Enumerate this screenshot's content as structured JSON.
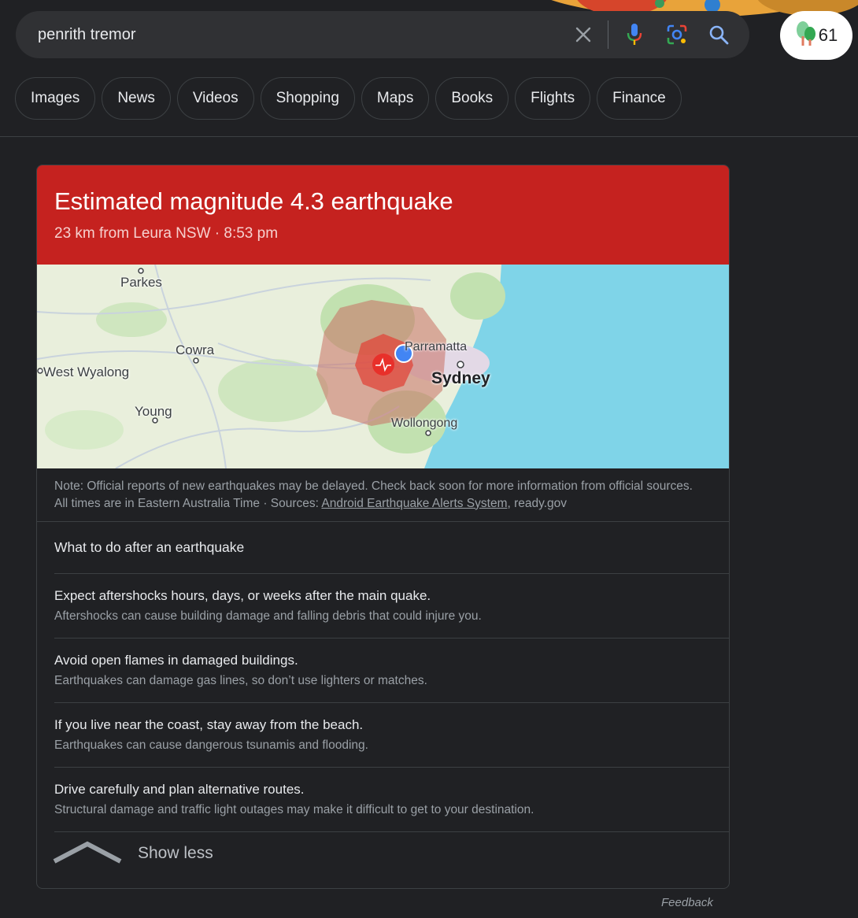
{
  "search": {
    "query": "penrith tremor",
    "clear_icon": "close-icon",
    "voice_icon": "microphone-icon",
    "lens_icon": "camera-lens-icon",
    "search_icon": "search-icon"
  },
  "badge": {
    "icon": "tree-icon",
    "count": "61"
  },
  "chips": [
    "Images",
    "News",
    "Videos",
    "Shopping",
    "Maps",
    "Books",
    "Flights",
    "Finance"
  ],
  "alert": {
    "title": "Estimated magnitude 4.3 earthquake",
    "subtitle": "23 km from Leura NSW · 8:53 pm",
    "color": "#c5221f"
  },
  "map": {
    "labels": [
      "Parkes",
      "Cowra",
      "West Wyalong",
      "Young",
      "Parramatta",
      "Sydney",
      "Wollongong"
    ]
  },
  "note": {
    "line1": "Note: Official reports of new earthquakes may be delayed. Check back soon for more information from official sources.",
    "line2_prefix": "All times are in Eastern Australia Time · Sources: ",
    "source_link": "Android Earthquake Alerts System",
    "line2_suffix": ", ready.gov"
  },
  "advice": {
    "heading": "What to do after an earthquake",
    "tips": [
      {
        "title": "Expect aftershocks hours, days, or weeks after the main quake.",
        "desc": "Aftershocks can cause building damage and falling debris that could injure you."
      },
      {
        "title": "Avoid open flames in damaged buildings.",
        "desc": "Earthquakes can damage gas lines, so don’t use lighters or matches."
      },
      {
        "title": "If you live near the coast, stay away from the beach.",
        "desc": "Earthquakes can cause dangerous tsunamis and flooding."
      },
      {
        "title": "Drive carefully and plan alternative routes.",
        "desc": "Structural damage and traffic light outages may make it difficult to get to your destination."
      }
    ]
  },
  "show_less": "Show less",
  "feedback": "Feedback"
}
